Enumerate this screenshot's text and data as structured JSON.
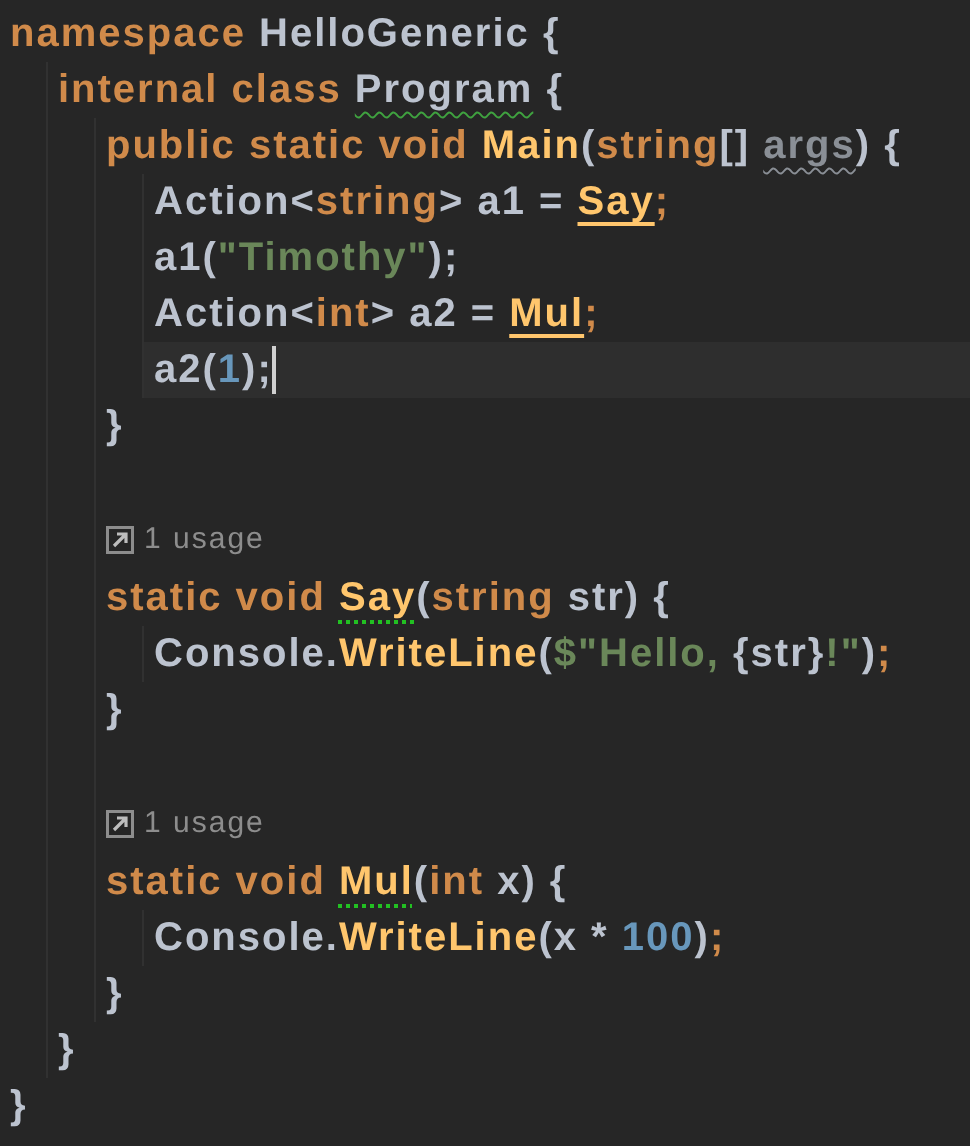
{
  "editor": {
    "lines": [
      {
        "kind": "code",
        "tokens": [
          {
            "text": "namespace ",
            "kind": "keyword"
          },
          {
            "text": "HelloGeneric {",
            "kind": "plain"
          }
        ],
        "children": [
          {
            "kind": "code",
            "tokens": [
              {
                "text": "internal class ",
                "kind": "keyword"
              },
              {
                "text": "Program",
                "kind": "plain",
                "squiggle": true
              },
              {
                "text": " {",
                "kind": "plain"
              }
            ],
            "children": [
              {
                "kind": "code",
                "tokens": [
                  {
                    "text": "public static void ",
                    "kind": "keyword"
                  },
                  {
                    "text": "Main",
                    "kind": "method"
                  },
                  {
                    "text": "(",
                    "kind": "plain"
                  },
                  {
                    "text": "string",
                    "kind": "keyword"
                  },
                  {
                    "text": "[] ",
                    "kind": "plain"
                  },
                  {
                    "text": "args",
                    "kind": "unused",
                    "squiggle": true
                  },
                  {
                    "text": ") {",
                    "kind": "plain"
                  }
                ],
                "children": [
                  {
                    "kind": "code",
                    "tokens": [
                      {
                        "text": "Action<",
                        "kind": "plain"
                      },
                      {
                        "text": "string",
                        "kind": "keyword"
                      },
                      {
                        "text": "> a1 = ",
                        "kind": "plain"
                      },
                      {
                        "text": "Say",
                        "kind": "method",
                        "usage_highlight": true
                      },
                      {
                        "text": ";",
                        "kind": "keyword"
                      }
                    ]
                  },
                  {
                    "kind": "code",
                    "tokens": [
                      {
                        "text": "a1(",
                        "kind": "plain"
                      },
                      {
                        "text": "\"Timothy\"",
                        "kind": "string"
                      },
                      {
                        "text": ");",
                        "kind": "plain"
                      }
                    ]
                  },
                  {
                    "kind": "code",
                    "tokens": [
                      {
                        "text": "Action<",
                        "kind": "plain"
                      },
                      {
                        "text": "int",
                        "kind": "keyword"
                      },
                      {
                        "text": "> a2 = ",
                        "kind": "plain"
                      },
                      {
                        "text": "Mul",
                        "kind": "method",
                        "usage_highlight": true
                      },
                      {
                        "text": ";",
                        "kind": "keyword"
                      }
                    ]
                  },
                  {
                    "kind": "code",
                    "current": true,
                    "tokens": [
                      {
                        "text": "a2(",
                        "kind": "plain"
                      },
                      {
                        "text": "1",
                        "kind": "number"
                      },
                      {
                        "text": ");",
                        "kind": "plain"
                      }
                    ]
                  }
                ]
              },
              {
                "kind": "code",
                "tokens": [
                  {
                    "text": "}",
                    "kind": "plain"
                  }
                ]
              },
              {
                "kind": "blank"
              },
              {
                "kind": "hint",
                "text": "1 usage"
              },
              {
                "kind": "code",
                "tokens": [
                  {
                    "text": "static void ",
                    "kind": "keyword"
                  },
                  {
                    "text": "Say",
                    "kind": "method",
                    "hint_dots": true
                  },
                  {
                    "text": "(",
                    "kind": "plain"
                  },
                  {
                    "text": "string",
                    "kind": "keyword"
                  },
                  {
                    "text": " str) {",
                    "kind": "plain"
                  }
                ],
                "children": [
                  {
                    "kind": "code",
                    "tokens": [
                      {
                        "text": "Console.",
                        "kind": "plain"
                      },
                      {
                        "text": "WriteLine",
                        "kind": "method"
                      },
                      {
                        "text": "(",
                        "kind": "plain"
                      },
                      {
                        "text": "$\"Hello, ",
                        "kind": "string"
                      },
                      {
                        "text": "{str}",
                        "kind": "plain"
                      },
                      {
                        "text": "!\"",
                        "kind": "string"
                      },
                      {
                        "text": ")",
                        "kind": "plain"
                      },
                      {
                        "text": ";",
                        "kind": "keyword"
                      }
                    ]
                  }
                ]
              },
              {
                "kind": "code",
                "tokens": [
                  {
                    "text": "}",
                    "kind": "plain"
                  }
                ]
              },
              {
                "kind": "blank"
              },
              {
                "kind": "hint",
                "text": "1 usage"
              },
              {
                "kind": "code",
                "tokens": [
                  {
                    "text": "static void ",
                    "kind": "keyword"
                  },
                  {
                    "text": "Mul",
                    "kind": "method",
                    "hint_dots": true
                  },
                  {
                    "text": "(",
                    "kind": "plain"
                  },
                  {
                    "text": "int",
                    "kind": "keyword"
                  },
                  {
                    "text": " x) {",
                    "kind": "plain"
                  }
                ],
                "children": [
                  {
                    "kind": "code",
                    "tokens": [
                      {
                        "text": "Console.",
                        "kind": "plain"
                      },
                      {
                        "text": "WriteLine",
                        "kind": "method"
                      },
                      {
                        "text": "(x * ",
                        "kind": "plain"
                      },
                      {
                        "text": "100",
                        "kind": "number"
                      },
                      {
                        "text": ")",
                        "kind": "plain"
                      },
                      {
                        "text": ";",
                        "kind": "keyword"
                      }
                    ]
                  }
                ]
              },
              {
                "kind": "code",
                "tokens": [
                  {
                    "text": "}",
                    "kind": "plain"
                  }
                ]
              }
            ]
          },
          {
            "kind": "code",
            "tokens": [
              {
                "text": "}",
                "kind": "plain"
              }
            ]
          }
        ]
      },
      {
        "kind": "code",
        "tokens": [
          {
            "text": "}",
            "kind": "plain"
          }
        ]
      }
    ]
  }
}
